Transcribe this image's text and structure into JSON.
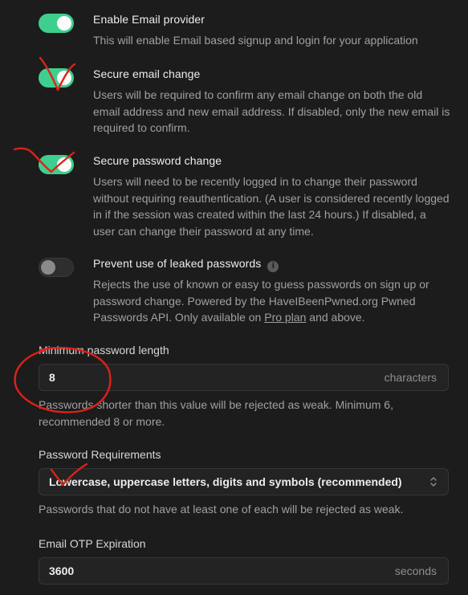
{
  "settings": [
    {
      "title": "Enable Email provider",
      "description": "This will enable Email based signup and login for your application",
      "enabled": true
    },
    {
      "title": "Secure email change",
      "description": "Users will be required to confirm any email change on both the old email address and new email address. If disabled, only the new email is required to confirm.",
      "enabled": true
    },
    {
      "title": "Secure password change",
      "description": "Users will need to be recently logged in to change their password without requiring reauthentication. (A user is considered recently logged in if the session was created within the last 24 hours.) If disabled, a user can change their password at any time.",
      "enabled": true
    },
    {
      "title": "Prevent use of leaked passwords",
      "description_prefix": "Rejects the use of known or easy to guess passwords on sign up or password change. Powered by the HaveIBeenPwned.org Pwned Passwords API. Only available on ",
      "link_text": "Pro plan",
      "description_suffix": " and above.",
      "enabled": false,
      "info_icon": "i"
    }
  ],
  "min_password_length": {
    "label": "Minimum password length",
    "value": "8",
    "suffix": "characters",
    "help": "Passwords shorter than this value will be rejected as weak. Minimum 6, recommended 8 or more."
  },
  "password_requirements": {
    "label": "Password Requirements",
    "selected": "Lowercase, uppercase letters, digits and symbols (recommended)",
    "help": "Passwords that do not have at least one of each will be rejected as weak."
  },
  "email_otp_expiration": {
    "label": "Email OTP Expiration",
    "value": "3600",
    "suffix": "seconds"
  },
  "colors": {
    "background": "#1c1c1c",
    "toggle_on": "#3ecf8e",
    "annotation_red": "#e0201a"
  }
}
